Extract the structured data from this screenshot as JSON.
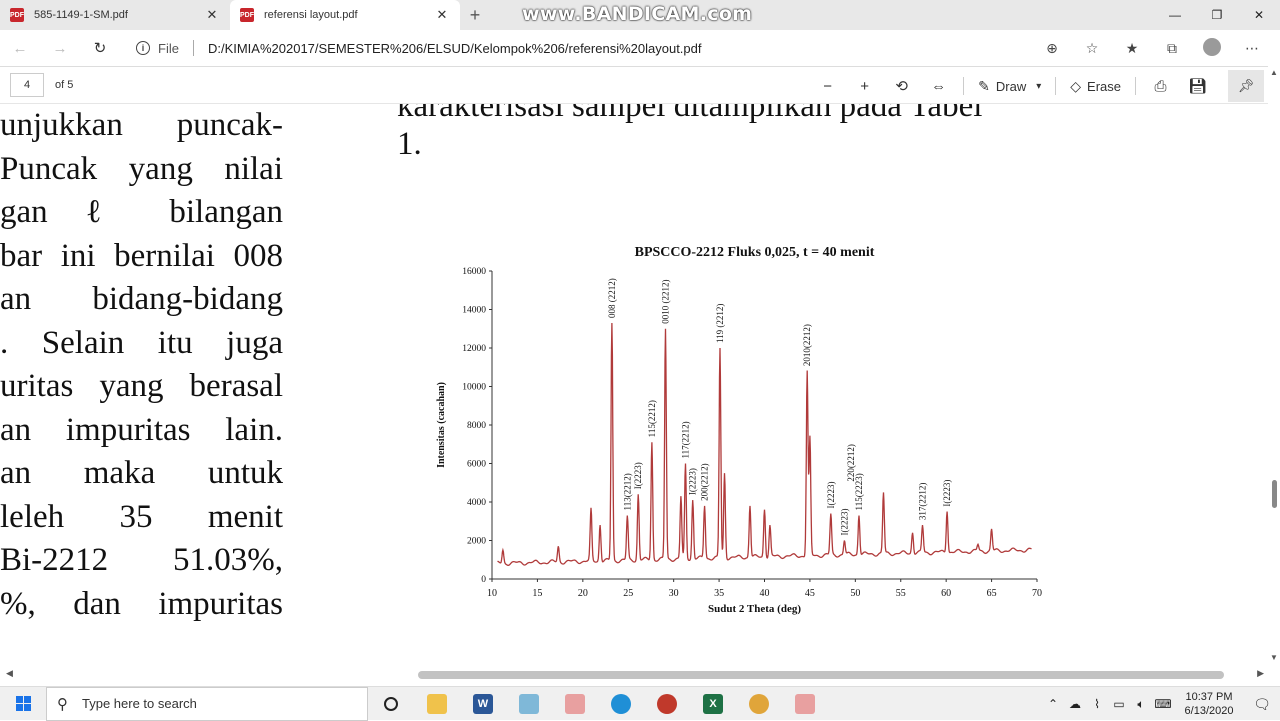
{
  "tabs": [
    {
      "label": "585-1149-1-SM.pdf",
      "close": "✕",
      "active": false
    },
    {
      "label": "referensi layout.pdf",
      "close": "✕",
      "active": true
    }
  ],
  "watermark": "www.BANDICAM.com",
  "address": {
    "file_label": "File",
    "url": "D:/KIMIA%202017/SEMESTER%206/ELSUD/Kelompok%206/referensi%20layout.pdf"
  },
  "pdf_toolbar": {
    "page": "4",
    "of_pages": "of 5",
    "draw_label": "Draw",
    "erase_label": "Erase"
  },
  "left_text": [
    "unjukkan puncak-",
    "Puncak yang nilai",
    "gan ℓ bilangan",
    "bar ini bernilai 008",
    "an bidang-bidang",
    ". Selain itu juga",
    "uritas yang berasal",
    "an impuritas lain.",
    "an maka untuk",
    "leleh 35 menit",
    "Bi-2212 51.03%,",
    "%, dan impuritas"
  ],
  "top_text": {
    "line1": "karakterisasi sampel ditampilkan pada Tabel",
    "line2": "1."
  },
  "chart_data": {
    "type": "line",
    "title": "BPSCCO-2212 Fluks 0,025, t = 40 menit",
    "xlabel": "Sudut 2 Theta (deg)",
    "ylabel": "Intensitas (cacahan)",
    "xlim": [
      10,
      70
    ],
    "ylim": [
      0,
      16000
    ],
    "xticks": [
      "10",
      "15",
      "20",
      "25",
      "30",
      "35",
      "40",
      "45",
      "50",
      "55",
      "60",
      "65",
      "70"
    ],
    "yticks": [
      "0",
      "2000",
      "4000",
      "6000",
      "8000",
      "10000",
      "12000",
      "14000",
      "16000"
    ],
    "series_color": "#b03a3a",
    "peaks": [
      {
        "x": 11.2,
        "y": 1500
      },
      {
        "x": 17.3,
        "y": 1700
      },
      {
        "x": 20.9,
        "y": 3700
      },
      {
        "x": 21.9,
        "y": 2800
      },
      {
        "x": 23.2,
        "y": 13300
      },
      {
        "x": 24.9,
        "y": 3300
      },
      {
        "x": 26.1,
        "y": 4400
      },
      {
        "x": 27.6,
        "y": 7100
      },
      {
        "x": 29.1,
        "y": 13000
      },
      {
        "x": 30.8,
        "y": 4300
      },
      {
        "x": 31.3,
        "y": 6000
      },
      {
        "x": 32.1,
        "y": 4100
      },
      {
        "x": 33.4,
        "y": 3800
      },
      {
        "x": 35.1,
        "y": 12000
      },
      {
        "x": 35.6,
        "y": 5500
      },
      {
        "x": 38.4,
        "y": 3800
      },
      {
        "x": 40.0,
        "y": 3600
      },
      {
        "x": 40.6,
        "y": 2800
      },
      {
        "x": 44.7,
        "y": 10800
      },
      {
        "x": 45.0,
        "y": 7400
      },
      {
        "x": 47.3,
        "y": 3400
      },
      {
        "x": 48.8,
        "y": 2000
      },
      {
        "x": 50.4,
        "y": 3300
      },
      {
        "x": 53.1,
        "y": 4500
      },
      {
        "x": 56.3,
        "y": 2400
      },
      {
        "x": 57.4,
        "y": 2800
      },
      {
        "x": 60.1,
        "y": 3500
      },
      {
        "x": 63.5,
        "y": 1800
      },
      {
        "x": 65.0,
        "y": 2600
      }
    ],
    "annotations": [
      {
        "x": 23.2,
        "y": 13300,
        "label": "008 (2212)"
      },
      {
        "x": 29.1,
        "y": 13000,
        "label": "0010 (2212)"
      },
      {
        "x": 35.1,
        "y": 12000,
        "label": "119 (2212)"
      },
      {
        "x": 44.7,
        "y": 10800,
        "label": "2010(2212)"
      },
      {
        "x": 27.6,
        "y": 7100,
        "label": "115(2212)"
      },
      {
        "x": 31.3,
        "y": 6000,
        "label": "117(2212)"
      },
      {
        "x": 24.9,
        "y": 3300,
        "label": "113(2212)"
      },
      {
        "x": 26.1,
        "y": 4400,
        "label": "I(2223)"
      },
      {
        "x": 32.1,
        "y": 4100,
        "label": "I(2223)"
      },
      {
        "x": 33.4,
        "y": 3800,
        "label": "200(2212)"
      },
      {
        "x": 47.3,
        "y": 3400,
        "label": "I(2223)"
      },
      {
        "x": 48.8,
        "y": 2000,
        "label": "I(2223)"
      },
      {
        "x": 49.5,
        "y": 4800,
        "label": "220(2212)"
      },
      {
        "x": 50.4,
        "y": 3300,
        "label": "115(2223)"
      },
      {
        "x": 57.4,
        "y": 2800,
        "label": "317(2212)"
      },
      {
        "x": 60.1,
        "y": 3500,
        "label": "I(2223)"
      }
    ]
  },
  "taskbar": {
    "search_placeholder": "Type here to search",
    "time": "10:37 PM",
    "date": "6/13/2020"
  }
}
